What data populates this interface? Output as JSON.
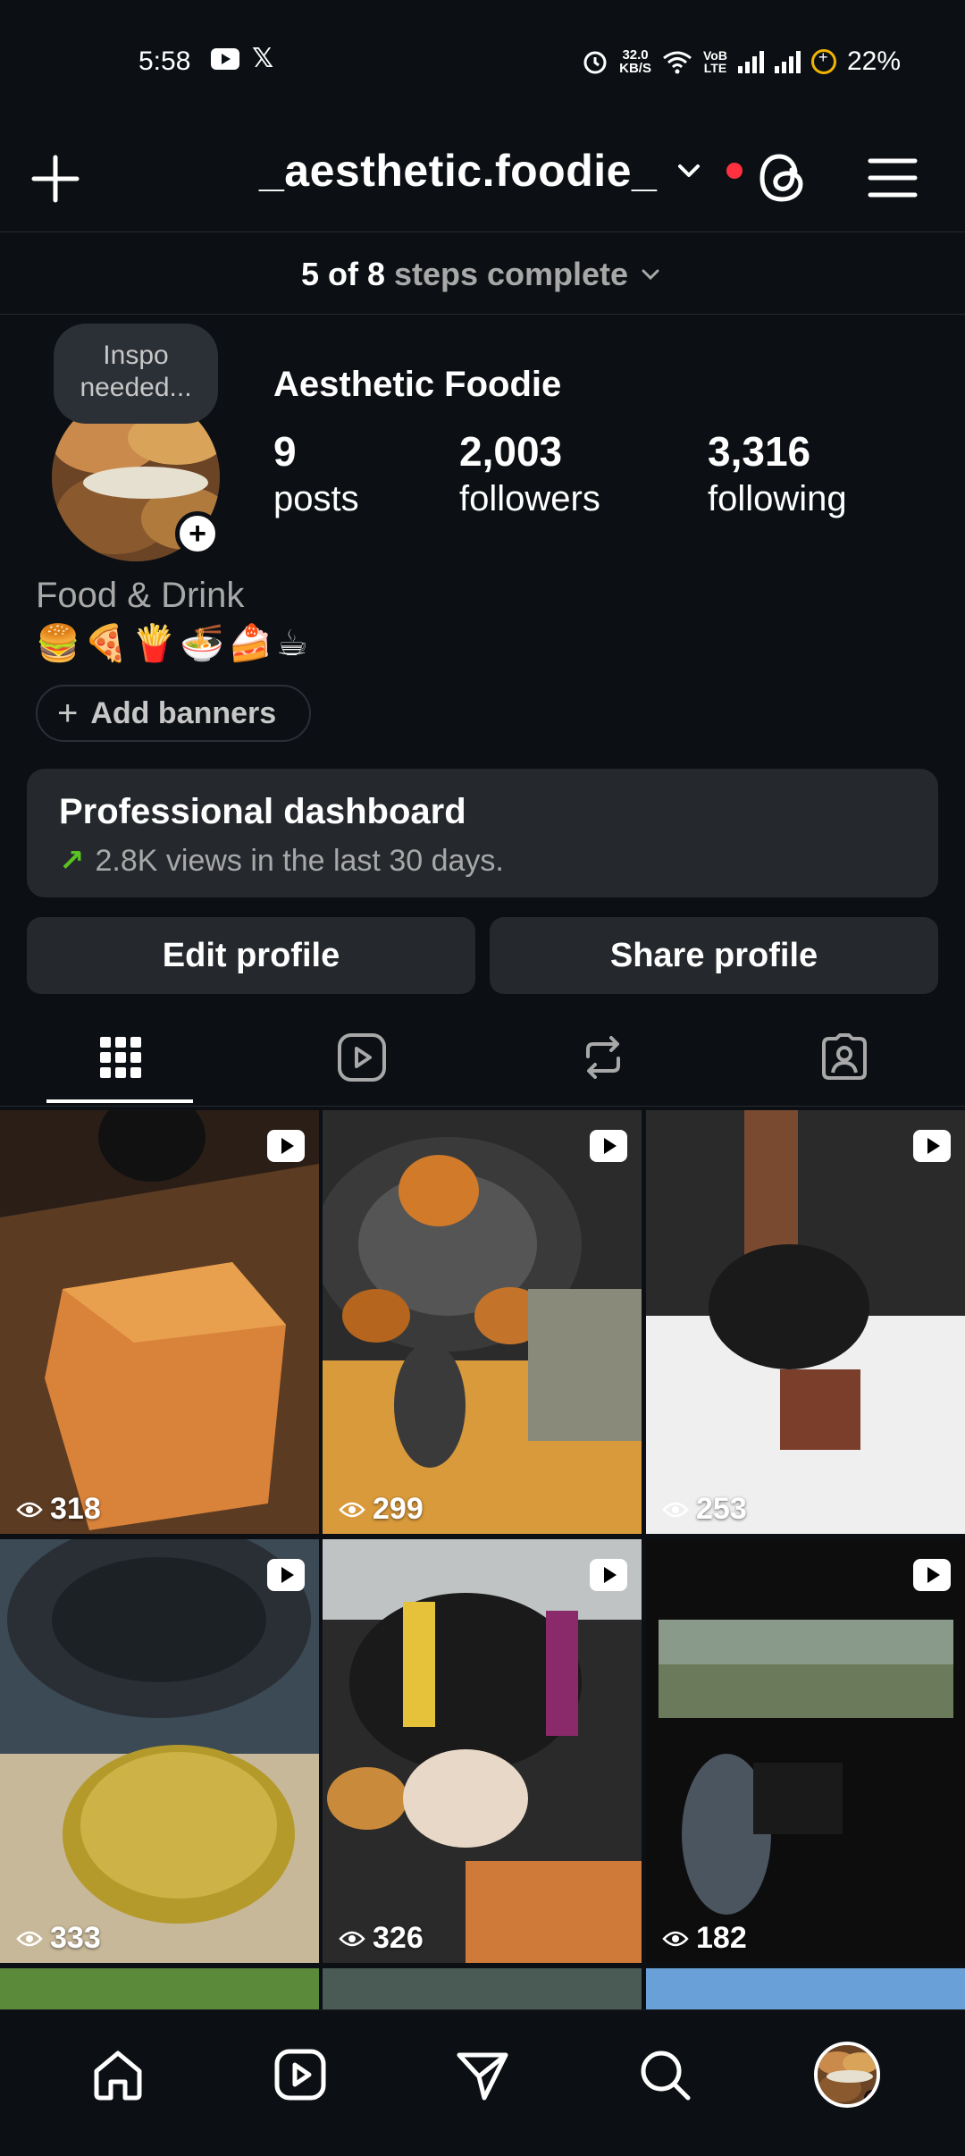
{
  "status_bar": {
    "time": "5:58",
    "speed_value": "32.0",
    "speed_unit": "KB/S",
    "network_label_top": "VoB",
    "network_label_bottom": "LTE",
    "battery": "22%"
  },
  "top_nav": {
    "username": "_aesthetic.foodie_"
  },
  "steps": {
    "progress": "5 of 8",
    "label": "steps complete"
  },
  "profile": {
    "note_line1": "Inspo",
    "note_line2": "needed...",
    "display_name": "Aesthetic Foodie",
    "stats": [
      {
        "value": "9",
        "label": "posts"
      },
      {
        "value": "2,003",
        "label": "followers"
      },
      {
        "value": "3,316",
        "label": "following"
      }
    ],
    "category": "Food & Drink",
    "bio_emojis": "🍔🍕🍟🍜🍰☕",
    "add_banners_label": "Add banners"
  },
  "dashboard": {
    "title": "Professional dashboard",
    "subtitle": "2.8K views in the last 30 days."
  },
  "actions": {
    "edit_label": "Edit profile",
    "share_label": "Share profile"
  },
  "tabs": [
    "grid-icon",
    "reels-icon",
    "reposts-icon",
    "tagged-icon"
  ],
  "grid": {
    "posts": [
      {
        "views": "318",
        "theme": "#8b5a2b"
      },
      {
        "views": "299",
        "theme": "#a8682a"
      },
      {
        "views": "253",
        "theme": "#e8e8e8"
      },
      {
        "views": "333",
        "theme": "#3b4a55"
      },
      {
        "views": "326",
        "theme": "#4c3a2e"
      },
      {
        "views": "182",
        "theme": "#1a1a1a"
      }
    ]
  },
  "bottom_nav": [
    "home-icon",
    "reels-icon",
    "direct-icon",
    "search-icon",
    "profile-avatar"
  ],
  "colors": {
    "background": "#0c1014",
    "surface": "#25292e",
    "accent_red": "#ff3040",
    "trend_green": "#58c322"
  }
}
